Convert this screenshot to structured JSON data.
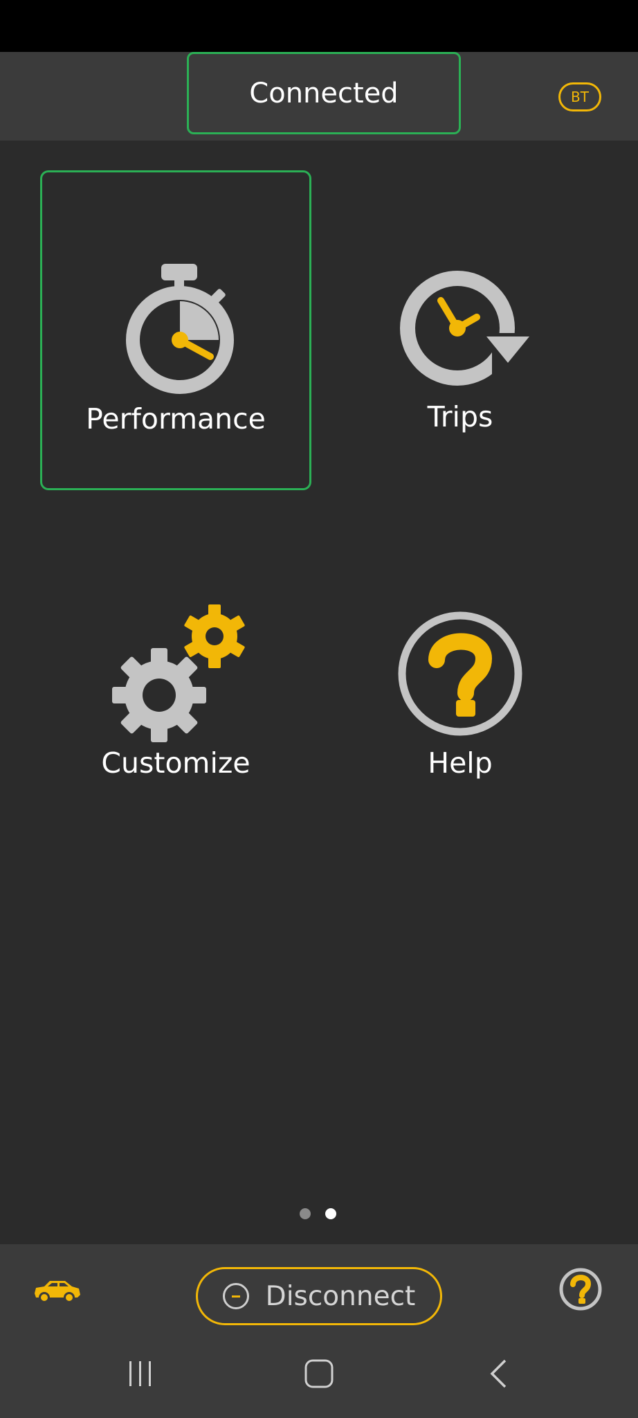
{
  "header": {
    "status": "Connected",
    "badge": "BT"
  },
  "tiles": [
    {
      "label": "Performance",
      "icon": "stopwatch-icon",
      "selected": true
    },
    {
      "label": "Trips",
      "icon": "trip-history-icon",
      "selected": false
    },
    {
      "label": "Customize",
      "icon": "gears-icon",
      "selected": false
    },
    {
      "label": "Help",
      "icon": "help-icon",
      "selected": false
    }
  ],
  "pager": {
    "pages": 2,
    "current": 2
  },
  "bottom": {
    "disconnect_label": "Disconnect"
  },
  "colors": {
    "accent": "#f2b707",
    "connected": "#2bb055",
    "icon_grey": "#c4c4c4"
  }
}
